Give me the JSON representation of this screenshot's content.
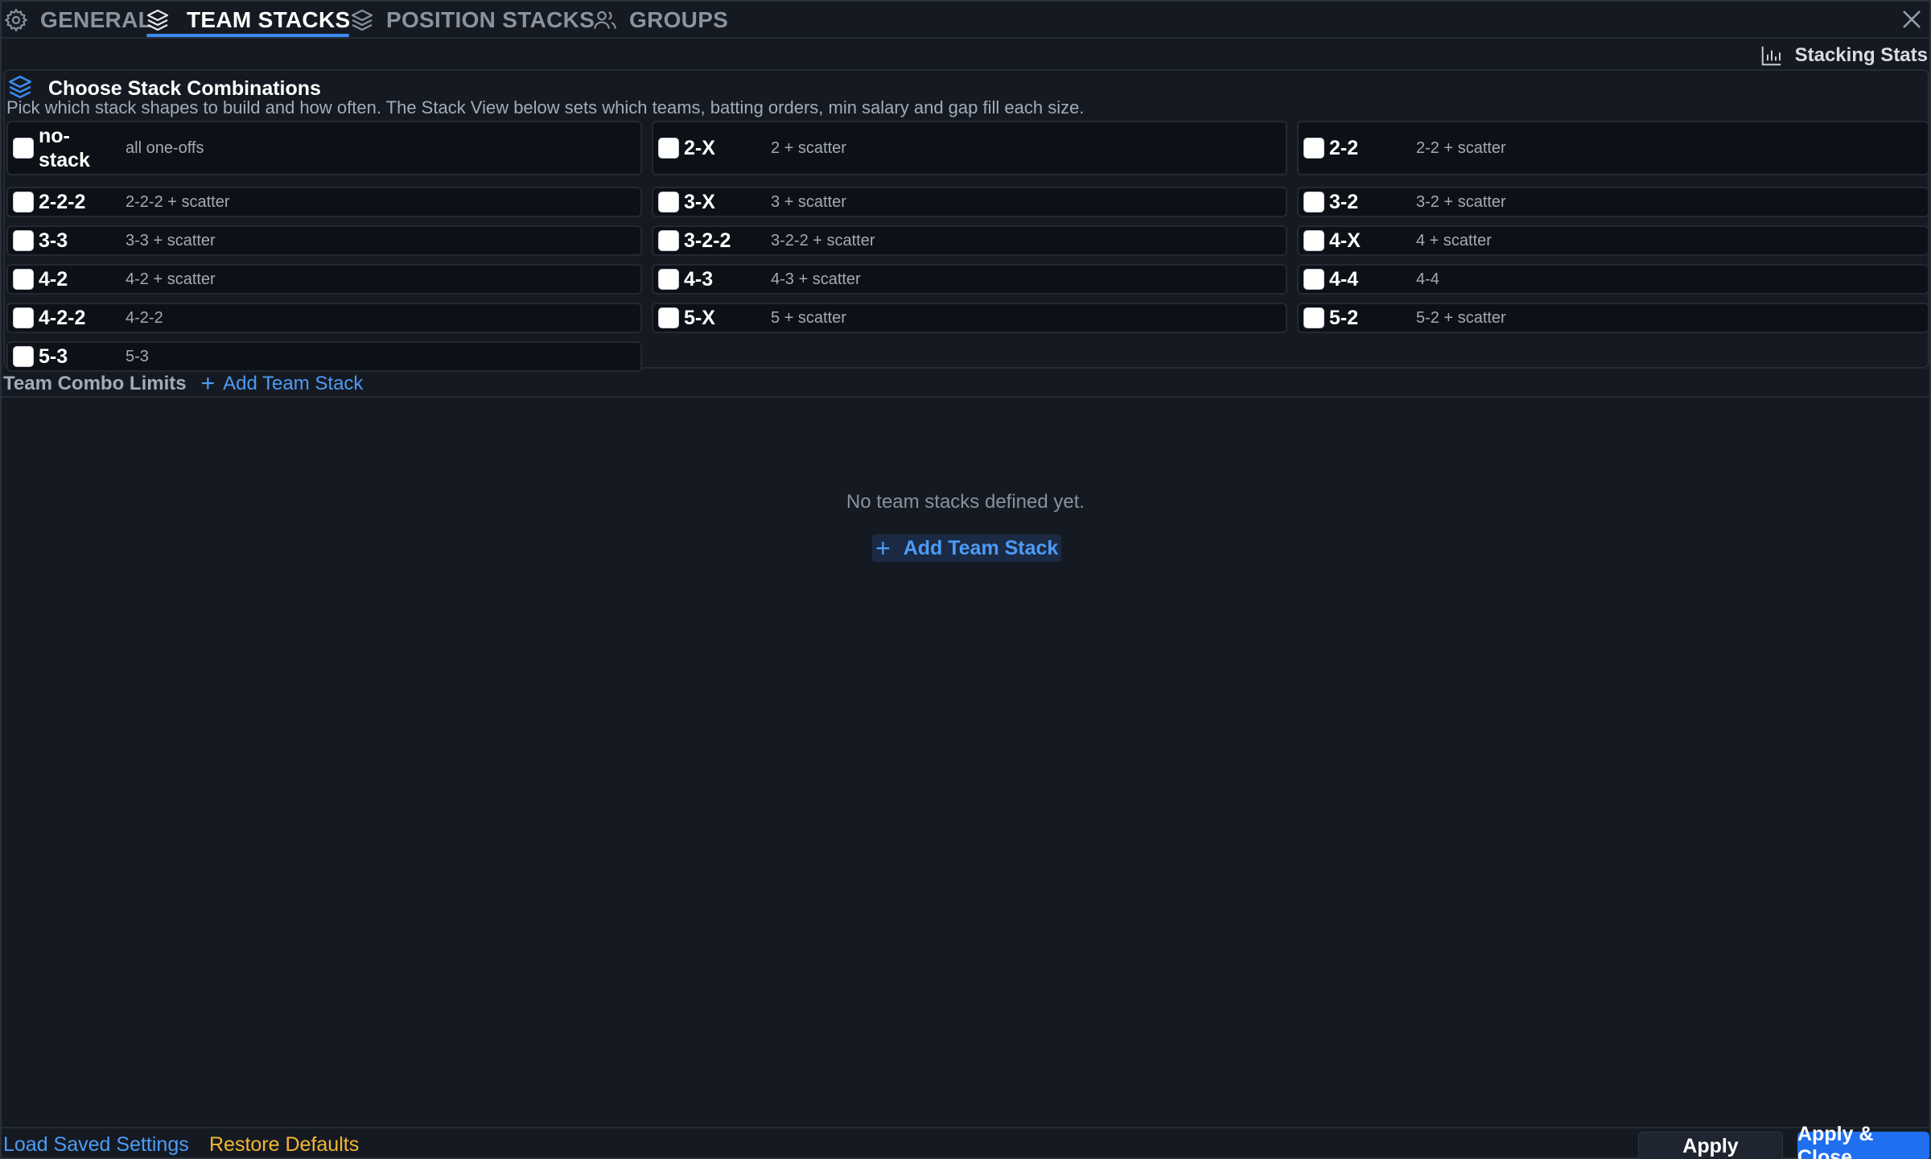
{
  "tabs": [
    {
      "label": "GENERAL",
      "icon": "gear-icon",
      "active": false
    },
    {
      "label": "TEAM STACKS",
      "icon": "layers-icon",
      "active": true
    },
    {
      "label": "POSITION STACKS",
      "icon": "layers-icon",
      "active": false
    },
    {
      "label": "GROUPS",
      "icon": "users-icon",
      "active": false
    }
  ],
  "header": {
    "stats_label": "Stacking Stats",
    "stats_icon": "bar-chart-icon",
    "close_icon": "close-icon"
  },
  "section": {
    "title": "Choose Stack Combinations",
    "icon": "layers-icon",
    "description": "Pick which stack shapes to build and how often. The Stack View below sets which teams, batting orders, min salary and gap fill each size.",
    "options": [
      {
        "label": "no-stack",
        "sub": "all one-offs",
        "checked": false
      },
      {
        "label": "2-X",
        "sub": "2 + scatter",
        "checked": false
      },
      {
        "label": "2-2",
        "sub": "2-2 + scatter",
        "checked": false
      },
      {
        "label": "2-2-2",
        "sub": "2-2-2 + scatter",
        "checked": false
      },
      {
        "label": "3-X",
        "sub": "3 + scatter",
        "checked": false
      },
      {
        "label": "3-2",
        "sub": "3-2 + scatter",
        "checked": false
      },
      {
        "label": "3-3",
        "sub": "3-3 + scatter",
        "checked": false
      },
      {
        "label": "3-2-2",
        "sub": "3-2-2 + scatter",
        "checked": false
      },
      {
        "label": "4-X",
        "sub": "4 + scatter",
        "checked": false
      },
      {
        "label": "4-2",
        "sub": "4-2 + scatter",
        "checked": false
      },
      {
        "label": "4-3",
        "sub": "4-3 + scatter",
        "checked": false
      },
      {
        "label": "4-4",
        "sub": "4-4",
        "checked": false
      },
      {
        "label": "4-2-2",
        "sub": "4-2-2",
        "checked": false
      },
      {
        "label": "5-X",
        "sub": "5 + scatter",
        "checked": false
      },
      {
        "label": "5-2",
        "sub": "5-2 + scatter",
        "checked": false
      },
      {
        "label": "5-3",
        "sub": "5-3",
        "checked": false
      }
    ]
  },
  "team_combo": {
    "title": "Team Combo Limits",
    "add_label": "Add Team Stack",
    "empty_message": "No team stacks defined yet.",
    "center_add_label": "Add Team Stack"
  },
  "footer": {
    "load_label": "Load Saved Settings",
    "restore_label": "Restore Defaults",
    "apply_label": "Apply",
    "apply_close_label": "Apply & Close"
  },
  "colors": {
    "accent": "#3b8cf0",
    "link": "#4d9bf5",
    "warning": "#f2b731",
    "primary_button": "#1f6ff0",
    "background": "#151a22"
  }
}
